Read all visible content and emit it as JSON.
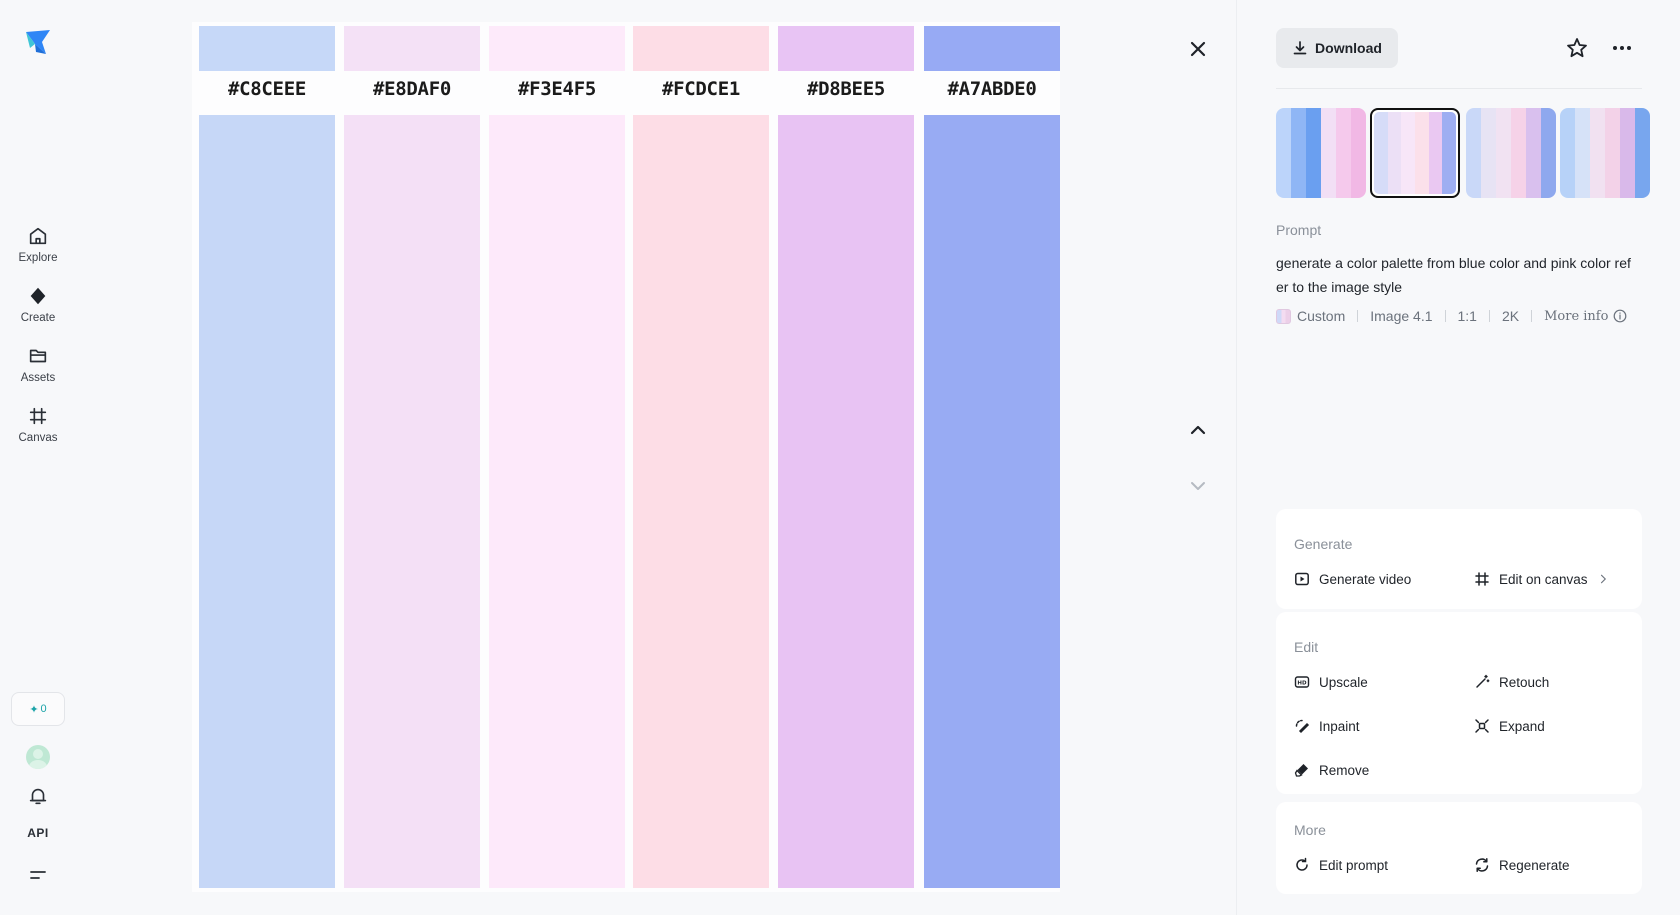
{
  "nav": {
    "items": [
      {
        "label": "Explore",
        "icon": "home-icon"
      },
      {
        "label": "Create",
        "icon": "create-diamond-icon"
      },
      {
        "label": "Assets",
        "icon": "folder-icon"
      },
      {
        "label": "Canvas",
        "icon": "canvas-frame-icon"
      }
    ],
    "credits": "0",
    "api_label": "API"
  },
  "palette": {
    "swatches": [
      {
        "label": "#C8CEEE",
        "top_color": "#c6d8f8",
        "body_color": "#c6d7f7"
      },
      {
        "label": "#E8DAF0",
        "top_color": "#f4e1f6",
        "body_color": "#f4e0f6"
      },
      {
        "label": "#F3E4F5",
        "top_color": "#fdeafa",
        "body_color": "#fde9fa"
      },
      {
        "label": "#FCDCE1",
        "top_color": "#fddde6",
        "body_color": "#fddde6"
      },
      {
        "label": "#D8BEE5",
        "top_color": "#e8c4f4",
        "body_color": "#e8c3f3"
      },
      {
        "label": "#A7ABDE0",
        "top_color": "#97aaf4",
        "body_color": "#98abf3"
      }
    ]
  },
  "panel": {
    "download_label": "Download",
    "thumbnails": [
      {
        "selected": false,
        "colors": [
          "#bcd4fa",
          "#8fb6f5",
          "#6a9ff0",
          "#f2dff5",
          "#f5c9ec",
          "#f1b8e5"
        ]
      },
      {
        "selected": true,
        "colors": [
          "#d6dcf8",
          "#ece0f6",
          "#f7e6f8",
          "#fbe0ea",
          "#eac8f2",
          "#9eaef2"
        ]
      },
      {
        "selected": false,
        "colors": [
          "#c9d8f8",
          "#e7e3f4",
          "#f1e2f2",
          "#f6d2e8",
          "#d9c0ee",
          "#8ea8ee"
        ]
      },
      {
        "selected": false,
        "colors": [
          "#b7d2f8",
          "#d6e2f8",
          "#f1e1f1",
          "#f3d2e8",
          "#d9b9ea",
          "#78a6ee"
        ]
      }
    ],
    "prompt_label": "Prompt",
    "prompt_text": "generate a color palette from blue color and pink color refer to the image style",
    "meta": {
      "style": "Custom",
      "model": "Image 4.1",
      "ratio": "1:1",
      "resolution": "2K",
      "more_info": "More info"
    },
    "generate": {
      "title": "Generate",
      "generate_video": "Generate video",
      "edit_on_canvas": "Edit on canvas"
    },
    "edit": {
      "title": "Edit",
      "upscale": "Upscale",
      "retouch": "Retouch",
      "inpaint": "Inpaint",
      "expand": "Expand",
      "remove": "Remove"
    },
    "more": {
      "title": "More",
      "edit_prompt": "Edit prompt",
      "regenerate": "Regenerate"
    }
  },
  "colors": {
    "accent_teal": "#1ba3a8",
    "logo_blue": "#2f86f6"
  }
}
